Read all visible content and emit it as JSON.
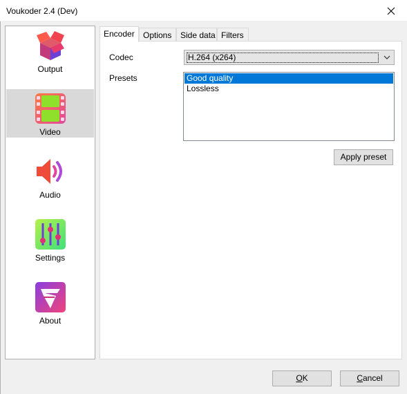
{
  "window": {
    "title": "Voukoder 2.4 (Dev)",
    "close_glyph": "✕"
  },
  "sidebar": {
    "items": [
      {
        "label": "Output",
        "icon": "output-box-icon",
        "selected": false
      },
      {
        "label": "Video",
        "icon": "video-film-icon",
        "selected": true
      },
      {
        "label": "Audio",
        "icon": "audio-speaker-icon",
        "selected": false
      },
      {
        "label": "Settings",
        "icon": "settings-sliders-icon",
        "selected": false
      },
      {
        "label": "About",
        "icon": "about-logo-icon",
        "selected": false
      }
    ]
  },
  "tabs": [
    {
      "label": "Encoder",
      "active": true
    },
    {
      "label": "Options",
      "active": false
    },
    {
      "label": "Side data",
      "active": false
    },
    {
      "label": "Filters",
      "active": false
    }
  ],
  "encoder": {
    "codec_label": "Codec",
    "codec_value": "H.264 (x264)",
    "presets_label": "Presets",
    "presets": [
      {
        "label": "Good quality",
        "selected": true
      },
      {
        "label": "Lossless",
        "selected": false
      }
    ],
    "apply_preset_label": "Apply preset"
  },
  "footer": {
    "ok_first": "O",
    "ok_rest": "K",
    "cancel_first": "C",
    "cancel_rest": "ancel"
  },
  "colors": {
    "selection": "#0078d7",
    "sidebar_selected": "#d9d9d9",
    "dialog_bg": "#f0f0f0"
  }
}
